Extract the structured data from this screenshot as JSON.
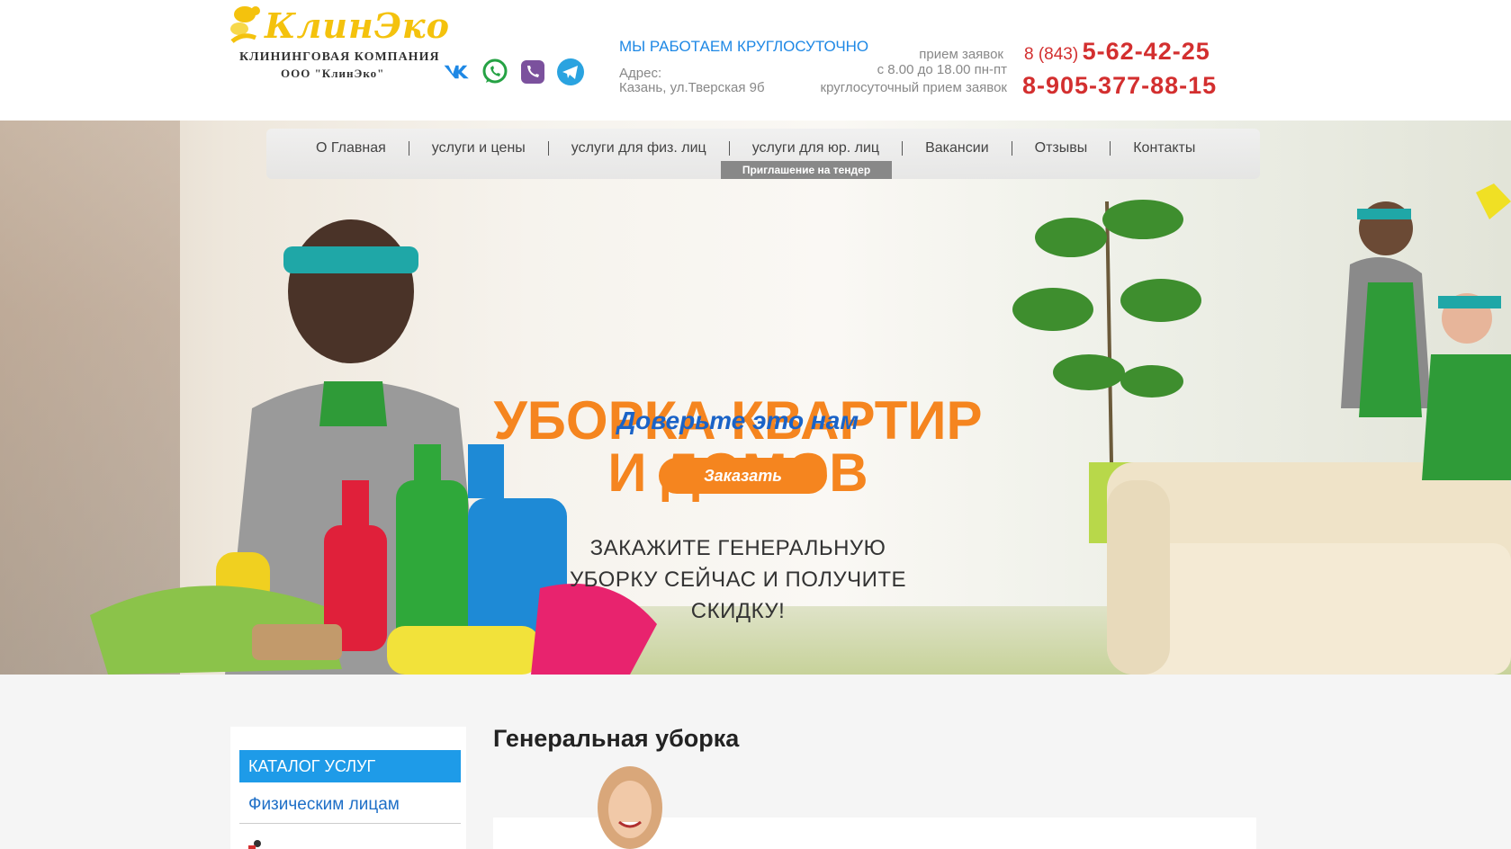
{
  "brand": {
    "name": "КлинЭко",
    "tagline": "КЛИНИНГОВАЯ КОМПАНИЯ",
    "legal_name": "ООО \"КлинЭко\""
  },
  "social": [
    {
      "icon": "vk-icon",
      "color": "#1e88e5"
    },
    {
      "icon": "whatsapp-icon",
      "color": "#25a244"
    },
    {
      "icon": "viber-icon",
      "color": "#7b519d"
    },
    {
      "icon": "telegram-icon",
      "color": "#2aa3e0"
    }
  ],
  "contacts": {
    "hours_title": "МЫ РАБОТАЕМ КРУГЛОСУТОЧНО",
    "address_label": "Адрес:",
    "address_value": "Казань, ул.Тверская 9б",
    "requests_label": "прием заявок",
    "requests_hours": "с 8.00 до 18.00 пн-пт",
    "requests_24h": "круглосуточный прием заявок",
    "phone1_code": "8 (843)",
    "phone1_number": "5-62-42-25",
    "phone2": "8-905-377-88-15"
  },
  "nav": {
    "items": [
      "О Главная",
      "услуги и цены",
      "услуги для физ. лиц",
      "услуги для юр. лиц",
      "Вакансии",
      "Отзывы",
      "Контакты"
    ],
    "sub_item": "Приглашение на тендер"
  },
  "hero": {
    "title_line1": "УБОРКА КВАРТИР",
    "title_line2": "И ДОМОВ",
    "subtitle": "Доверьте это нам",
    "button": "Заказать",
    "promo_line1": "ЗАКАЖИТЕ ГЕНЕРАЛЬНУЮ",
    "promo_line2": "УБОРКУ СЕЙЧАС И ПОЛУЧИТЕ",
    "promo_line3": "СКИДКУ!"
  },
  "sidebar": {
    "catalog_title": "КАТАЛОГ УСЛУГ",
    "item1": "Физическим лицам"
  },
  "main": {
    "title": "Генеральная уборка"
  },
  "colors": {
    "accent_orange": "#f5851f",
    "accent_blue": "#1e9be8",
    "phone_red": "#d32f2f",
    "logo_yellow": "#f4c20d"
  }
}
